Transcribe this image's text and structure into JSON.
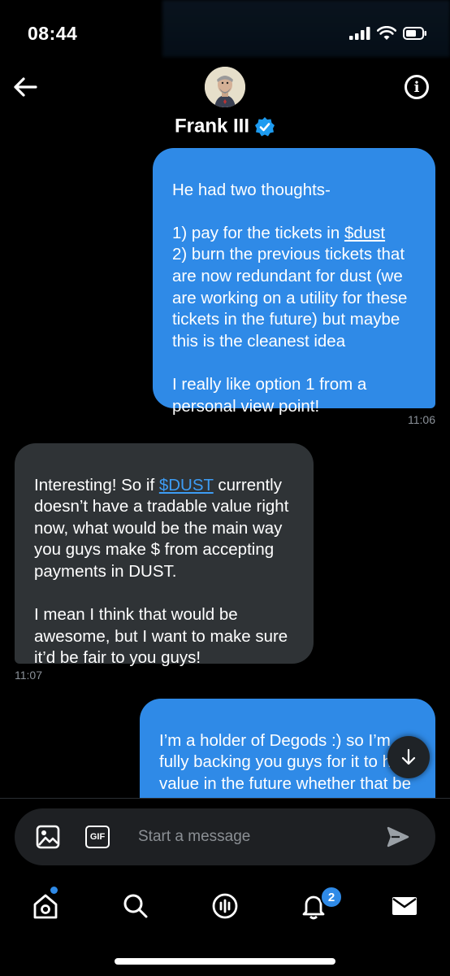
{
  "status_bar": {
    "time": "08:44"
  },
  "header": {
    "name": "Frank III",
    "icons": [
      "back-arrow-icon",
      "info-icon",
      "verified-badge-icon"
    ]
  },
  "messages": [
    {
      "type": "sent",
      "lines": {
        "l1": "He had two thoughts-",
        "l2_pre": "1) pay for the tickets in ",
        "l2_link": "$dust",
        "l3": "2) burn the previous tickets that are now redundant for dust (we are working on a utility for these tickets in the future) but maybe this is the cleanest idea",
        "l4": "I really like option 1 from a personal view point!"
      },
      "time": "11:06"
    },
    {
      "type": "received",
      "lines": {
        "l1_pre": "Interesting! So if ",
        "l1_link": "$DUST",
        "l1_post": " currently doesn’t have a tradable value right now, what would be the main way you guys make $ from accepting payments in DUST.",
        "l2": "I mean I think that would be awesome, but I want to make sure it’d be fair to you guys!"
      },
      "time": "11:07"
    },
    {
      "type": "sent",
      "text": "I’m a holder of Degods :) so I’m fully backing you guys for it to have value in the future whether that be tradeable or utility based"
    }
  ],
  "composer": {
    "placeholder": "Start a message",
    "buttons": [
      "image-icon",
      "gif-icon",
      "send-icon"
    ],
    "gif_label": "GIF"
  },
  "bottom_nav": {
    "items": [
      "home-icon",
      "search-icon",
      "spaces-icon",
      "notifications-icon",
      "messages-icon"
    ],
    "notification_count": "2"
  },
  "colors": {
    "accent": "#2f8ae7",
    "received_bubble": "#2f3336",
    "background": "#000000"
  }
}
